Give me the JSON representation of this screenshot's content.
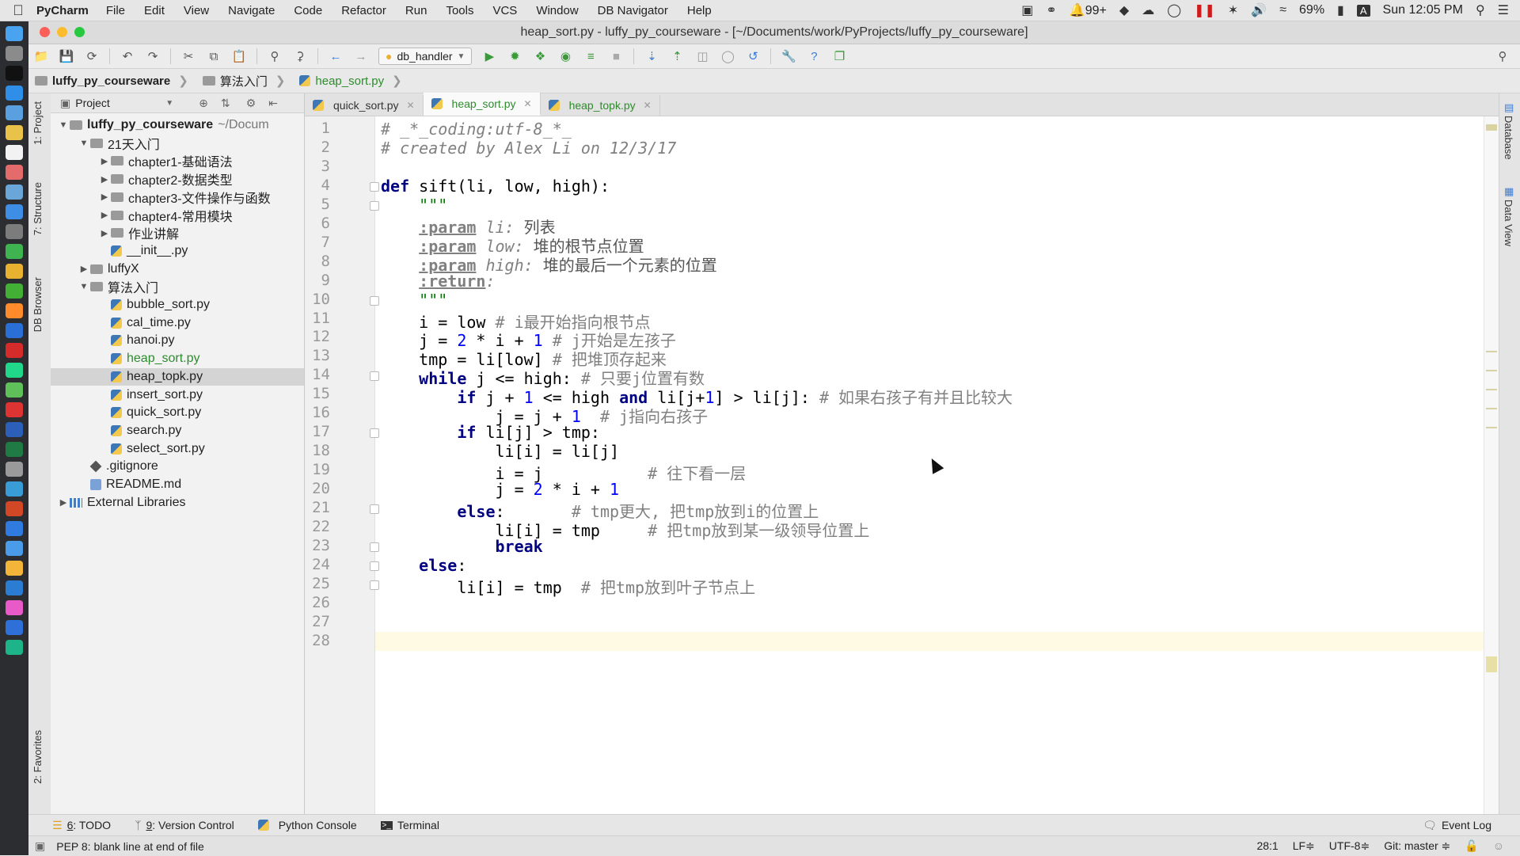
{
  "menubar": {
    "app_name": "PyCharm",
    "items": [
      "File",
      "Edit",
      "View",
      "Navigate",
      "Code",
      "Refactor",
      "Run",
      "Tools",
      "VCS",
      "Window",
      "DB Navigator",
      "Help"
    ],
    "notifications": "99+",
    "battery": "69%",
    "input_source": "A",
    "clock": "Sun 12:05 PM"
  },
  "window": {
    "title": "heap_sort.py - luffy_py_courseware - [~/Documents/work/PyProjects/luffy_py_courseware]"
  },
  "toolbar": {
    "run_config": "db_handler"
  },
  "breadcrumb": [
    "luffy_py_courseware",
    "算法入门",
    "heap_sort.py"
  ],
  "left_strip": {
    "project": "1: Project",
    "structure": "7: Structure",
    "db_browser": "DB Browser",
    "favorites": "2: Favorites"
  },
  "right_strip": {
    "database": "Database",
    "data_view": "Data View"
  },
  "project_panel": {
    "header": "Project",
    "tree": [
      {
        "label": "luffy_py_courseware",
        "extra": "~/Docum",
        "type": "root",
        "expanded": true,
        "depth": 0
      },
      {
        "label": "21天入门",
        "type": "folder",
        "expanded": true,
        "depth": 1
      },
      {
        "label": "chapter1-基础语法",
        "type": "folder",
        "expanded": false,
        "depth": 2
      },
      {
        "label": "chapter2-数据类型",
        "type": "folder",
        "expanded": false,
        "depth": 2
      },
      {
        "label": "chapter3-文件操作与函数",
        "type": "folder",
        "expanded": false,
        "depth": 2
      },
      {
        "label": "chapter4-常用模块",
        "type": "folder",
        "expanded": false,
        "depth": 2
      },
      {
        "label": "作业讲解",
        "type": "folder",
        "expanded": false,
        "depth": 2
      },
      {
        "label": "__init__.py",
        "type": "py",
        "depth": 2
      },
      {
        "label": "luffyX",
        "type": "folder",
        "expanded": false,
        "depth": 1
      },
      {
        "label": "算法入门",
        "type": "folder",
        "expanded": true,
        "depth": 1
      },
      {
        "label": "bubble_sort.py",
        "type": "py",
        "depth": 2
      },
      {
        "label": "cal_time.py",
        "type": "py",
        "depth": 2
      },
      {
        "label": "hanoi.py",
        "type": "py",
        "depth": 2
      },
      {
        "label": "heap_sort.py",
        "type": "py",
        "depth": 2,
        "modified": true
      },
      {
        "label": "heap_topk.py",
        "type": "py",
        "depth": 2,
        "selected": true
      },
      {
        "label": "insert_sort.py",
        "type": "py",
        "depth": 2
      },
      {
        "label": "quick_sort.py",
        "type": "py",
        "depth": 2
      },
      {
        "label": "search.py",
        "type": "py",
        "depth": 2
      },
      {
        "label": "select_sort.py",
        "type": "py",
        "depth": 2
      },
      {
        "label": ".gitignore",
        "type": "git",
        "depth": 1
      },
      {
        "label": "README.md",
        "type": "md",
        "depth": 1
      },
      {
        "label": "External Libraries",
        "type": "lib",
        "expanded": false,
        "depth": 0
      }
    ]
  },
  "tabs": [
    {
      "label": "quick_sort.py",
      "active": false
    },
    {
      "label": "heap_sort.py",
      "active": true
    },
    {
      "label": "heap_topk.py",
      "active": false
    }
  ],
  "editor": {
    "current_line": 28,
    "lines": [
      [
        [
          "cm",
          "# _*_coding:utf-8_*_"
        ]
      ],
      [
        [
          "cm",
          "# created by Alex Li on 12/3/17"
        ]
      ],
      [],
      [
        [
          "kw",
          "def "
        ],
        [
          "t",
          "sift(li, low, high):"
        ]
      ],
      [
        [
          "t",
          "    "
        ],
        [
          "doc",
          "\"\"\""
        ]
      ],
      [
        [
          "t",
          "    "
        ],
        [
          "dtag",
          ":param"
        ],
        [
          "t",
          " "
        ],
        [
          "dname",
          "li:"
        ],
        [
          "dtxt",
          " 列表"
        ]
      ],
      [
        [
          "t",
          "    "
        ],
        [
          "dtag",
          ":param"
        ],
        [
          "t",
          " "
        ],
        [
          "dname",
          "low:"
        ],
        [
          "dtxt",
          " 堆的根节点位置"
        ]
      ],
      [
        [
          "t",
          "    "
        ],
        [
          "dtag",
          ":param"
        ],
        [
          "t",
          " "
        ],
        [
          "dname",
          "high:"
        ],
        [
          "dtxt",
          " 堆的最后一个元素的位置"
        ]
      ],
      [
        [
          "t",
          "    "
        ],
        [
          "dtag",
          ":return"
        ],
        [
          "dname",
          ":"
        ]
      ],
      [
        [
          "t",
          "    "
        ],
        [
          "doc",
          "\"\"\""
        ]
      ],
      [
        [
          "t",
          "    i = low "
        ],
        [
          "cmz",
          "# i最开始指向根节点"
        ]
      ],
      [
        [
          "t",
          "    j = "
        ],
        [
          "num",
          "2"
        ],
        [
          "t",
          " * i + "
        ],
        [
          "num",
          "1"
        ],
        [
          "t",
          " "
        ],
        [
          "cmz",
          "# j开始是左孩子"
        ]
      ],
      [
        [
          "t",
          "    tmp = li[low] "
        ],
        [
          "cmz",
          "# 把堆顶存起来"
        ]
      ],
      [
        [
          "t",
          "    "
        ],
        [
          "kw",
          "while"
        ],
        [
          "t",
          " j <= high: "
        ],
        [
          "cmz",
          "# 只要j位置有数"
        ]
      ],
      [
        [
          "t",
          "        "
        ],
        [
          "kw",
          "if"
        ],
        [
          "t",
          " j + "
        ],
        [
          "num",
          "1"
        ],
        [
          "t",
          " <= high "
        ],
        [
          "kw",
          "and"
        ],
        [
          "t",
          " li[j+"
        ],
        [
          "num",
          "1"
        ],
        [
          "t",
          "] > li[j]: "
        ],
        [
          "cmz",
          "# 如果右孩子有并且比较大"
        ]
      ],
      [
        [
          "t",
          "            j = j + "
        ],
        [
          "num",
          "1"
        ],
        [
          "t",
          "  "
        ],
        [
          "cmz",
          "# j指向右孩子"
        ]
      ],
      [
        [
          "t",
          "        "
        ],
        [
          "kw",
          "if"
        ],
        [
          "t",
          " li[j] > tmp:"
        ]
      ],
      [
        [
          "t",
          "            li[i] = li[j]"
        ]
      ],
      [
        [
          "t",
          "            i = j           "
        ],
        [
          "cmz",
          "# 往下看一层"
        ]
      ],
      [
        [
          "t",
          "            j = "
        ],
        [
          "num",
          "2"
        ],
        [
          "t",
          " * i + "
        ],
        [
          "num",
          "1"
        ]
      ],
      [
        [
          "t",
          "        "
        ],
        [
          "kw",
          "else"
        ],
        [
          "t",
          ":       "
        ],
        [
          "cmz",
          "# tmp更大, 把tmp放到i的位置上"
        ]
      ],
      [
        [
          "t",
          "            li[i] = tmp     "
        ],
        [
          "cmz",
          "# 把tmp放到某一级领导位置上"
        ]
      ],
      [
        [
          "t",
          "            "
        ],
        [
          "kw",
          "break"
        ]
      ],
      [
        [
          "t",
          "    "
        ],
        [
          "kw",
          "else"
        ],
        [
          "t",
          ":"
        ]
      ],
      [
        [
          "t",
          "        li[i] = tmp  "
        ],
        [
          "cmz",
          "# 把tmp放到叶子节点上"
        ]
      ],
      [],
      [],
      []
    ]
  },
  "bottom_tools": [
    {
      "key": "6",
      "label": ": TODO"
    },
    {
      "key": "9",
      "label": ": Version Control"
    },
    {
      "key": "",
      "label": "Python Console"
    },
    {
      "key": "",
      "label": "Terminal"
    }
  ],
  "event_log": "Event Log",
  "status": {
    "message": "PEP 8: blank line at end of file",
    "position": "28:1",
    "line_sep": "LF≑",
    "encoding": "UTF-8≑",
    "git": "Git: master ≑"
  },
  "colors": {
    "keyword": "#000080",
    "number": "#0000ff",
    "comment": "#808080",
    "modified_file": "#2e8b2e",
    "current_line": "#fffae3"
  }
}
